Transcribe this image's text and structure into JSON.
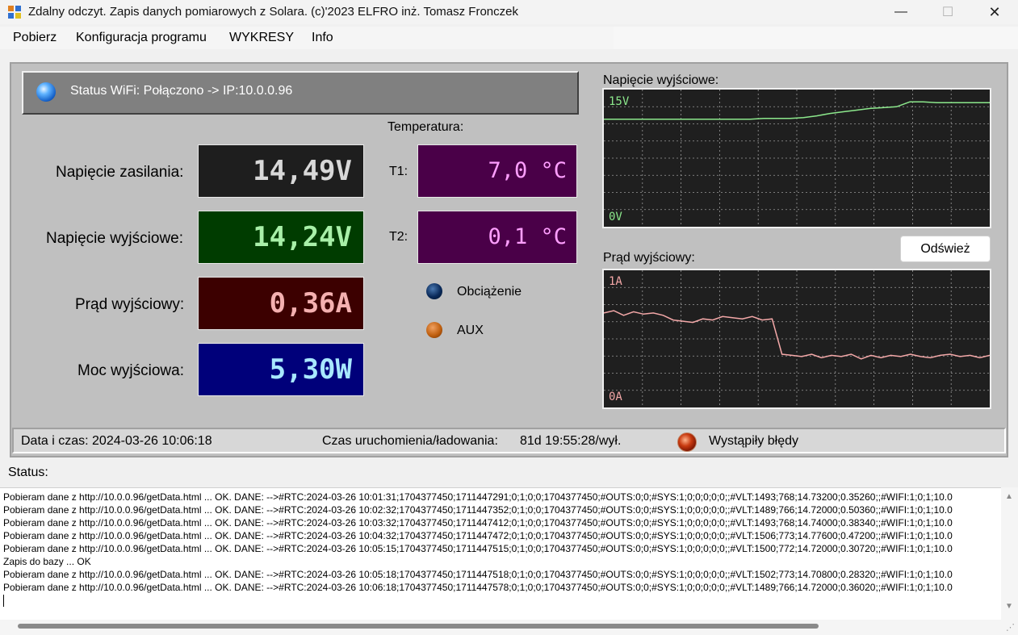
{
  "window": {
    "title": "Zdalny odczyt. Zapis danych pomiarowych z Solara. (c)'2023 ELFRO inż. Tomasz Fronczek",
    "minimize": "—",
    "maximize": "☐",
    "close": "✕"
  },
  "menu": [
    "Pobierz",
    "Konfiguracja programu",
    "WYKRESY",
    "Info"
  ],
  "wifi_status": "Status WiFi: Połączono -> IP:10.0.0.96",
  "readings": [
    {
      "label": "Napięcie zasilania:",
      "value": "14,49V",
      "bg": "#1e1e1e",
      "color": "#d8d8d8"
    },
    {
      "label": "Napięcie wyjściowe:",
      "value": "14,24V",
      "bg": "#003c00",
      "color": "#a8f0a8"
    },
    {
      "label": "Prąd wyjściowy:",
      "value": "0,36A",
      "bg": "#3c0000",
      "color": "#f4b0b0"
    },
    {
      "label": "Moc wyjściowa:",
      "value": "5,30W",
      "bg": "#00007a",
      "color": "#a8e8ff"
    }
  ],
  "temperature": {
    "title": "Temperatura:",
    "t1_label": "T1:",
    "t1_value": "7,0 °C",
    "t2_label": "T2:",
    "t2_value": "0,1 °C"
  },
  "indicators": {
    "load_label": "Obciążenie",
    "load_color": "#0a2a5a",
    "aux_label": "AUX",
    "aux_color": "#c06010"
  },
  "charts": {
    "voltage": {
      "title": "Napięcie wyjściowe:",
      "top_label": "15V",
      "bottom_label": "0V",
      "line_color": "#8ce88c"
    },
    "current": {
      "title": "Prąd wyjściowy:",
      "top_label": "1A",
      "bottom_label": "0A",
      "line_color": "#f4a8a8"
    },
    "refresh_button": "Odśwież"
  },
  "chart_data": [
    {
      "type": "line",
      "ylim": [
        0,
        15
      ],
      "series": [
        {
          "values": [
            12.2,
            12.2,
            12.2,
            12.2,
            12.2,
            12.2,
            12.2,
            12.2,
            12.2,
            12.2,
            12.2,
            12.2,
            12.3,
            12.3,
            12.3,
            12.4,
            12.6,
            12.9,
            13.1,
            13.3,
            13.5,
            13.6,
            13.7,
            14.3,
            14.3,
            14.2,
            14.2,
            14.2,
            14.2,
            14.2
          ]
        }
      ]
    },
    {
      "type": "line",
      "ylim": [
        0,
        1
      ],
      "series": [
        {
          "values": [
            0.72,
            0.74,
            0.7,
            0.73,
            0.71,
            0.72,
            0.7,
            0.66,
            0.65,
            0.64,
            0.67,
            0.66,
            0.69,
            0.68,
            0.67,
            0.69,
            0.66,
            0.67,
            0.37,
            0.36,
            0.35,
            0.37,
            0.34,
            0.36,
            0.35,
            0.37,
            0.33,
            0.36,
            0.34,
            0.36,
            0.35,
            0.37,
            0.35,
            0.34,
            0.36,
            0.37,
            0.35,
            0.36,
            0.34,
            0.36
          ]
        }
      ]
    }
  ],
  "status_strip": {
    "datetime": "Data i czas: 2024-03-26 10:06:18",
    "uptime_label": "Czas uruchomienia/ładowania:",
    "uptime_value": "81d 19:55:28/wył.",
    "error_text": "Wystąpiły błędy"
  },
  "status_label": "Status:",
  "log_lines": [
    "Pobieram dane z http://10.0.0.96/getData.html ... OK.  DANE: -->#RTC:2024-03-26 10:01:31;1704377450;1711447291;0;1;0;0;1704377450;#OUTS:0;0;#SYS:1;0;0;0;0;0;;#VLT:1493;768;14.73200;0.35260;;#WIFI:1;0;1;10.0",
    "Pobieram dane z http://10.0.0.96/getData.html ... OK.  DANE: -->#RTC:2024-03-26 10:02:32;1704377450;1711447352;0;1;0;0;1704377450;#OUTS:0;0;#SYS:1;0;0;0;0;0;;#VLT:1489;766;14.72000;0.50360;;#WIFI:1;0;1;10.0",
    "Pobieram dane z http://10.0.0.96/getData.html ... OK.  DANE: -->#RTC:2024-03-26 10:03:32;1704377450;1711447412;0;1;0;0;1704377450;#OUTS:0;0;#SYS:1;0;0;0;0;0;;#VLT:1493;768;14.74000;0.38340;;#WIFI:1;0;1;10.0",
    "Pobieram dane z http://10.0.0.96/getData.html ... OK.  DANE: -->#RTC:2024-03-26 10:04:32;1704377450;1711447472;0;1;0;0;1704377450;#OUTS:0;0;#SYS:1;0;0;0;0;0;;#VLT:1506;773;14.77600;0.47200;;#WIFI:1;0;1;10.0",
    "Pobieram dane z http://10.0.0.96/getData.html ... OK.  DANE: -->#RTC:2024-03-26 10:05:15;1704377450;1711447515;0;1;0;0;1704377450;#OUTS:0;0;#SYS:1;0;0;0;0;0;;#VLT:1500;772;14.72000;0.30720;;#WIFI:1;0;1;10.0",
    "Zapis do bazy ... OK",
    "Pobieram dane z http://10.0.0.96/getData.html ... OK.  DANE: -->#RTC:2024-03-26 10:05:18;1704377450;1711447518;0;1;0;0;1704377450;#OUTS:0;0;#SYS:1;0;0;0;0;0;;#VLT:1502;773;14.70800;0.28320;;#WIFI:1;0;1;10.0",
    "Pobieram dane z http://10.0.0.96/getData.html ... OK.  DANE: -->#RTC:2024-03-26 10:06:18;1704377450;1711447578;0;1;0;0;1704377450;#OUTS:0;0;#SYS:1;0;0;0;0;0;;#VLT:1489;766;14.72000;0.36020;;#WIFI:1;0;1;10.0"
  ]
}
